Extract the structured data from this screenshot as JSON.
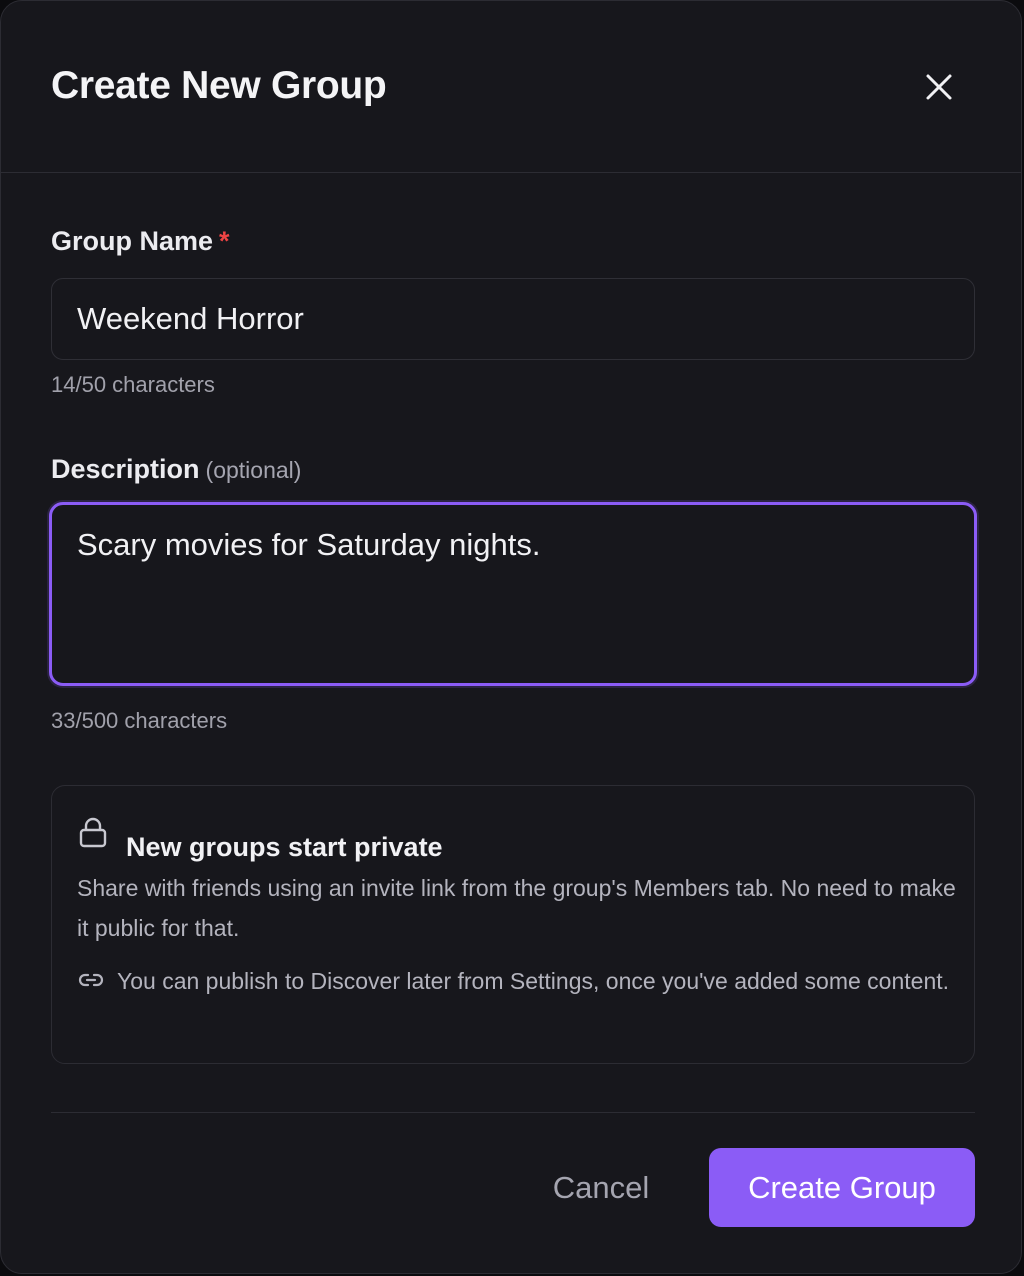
{
  "dialog": {
    "title": "Create New Group",
    "close_icon": "close-icon"
  },
  "form": {
    "name": {
      "label": "Group Name",
      "required_mark": "*",
      "value": "Weekend Horror",
      "counter": "14/50 characters"
    },
    "description": {
      "label": "Description",
      "optional_text": "(optional)",
      "value": "Scary movies for Saturday nights.",
      "counter": "33/500 characters"
    }
  },
  "info": {
    "icon": "lock-icon",
    "title": "New groups start private",
    "text": "Share with friends using an invite link from the group's Members tab. No need to make it public for that.",
    "sub_icon": "link-icon",
    "sub_text": "You can publish to Discover later from Settings, once you've added some content."
  },
  "footer": {
    "cancel_label": "Cancel",
    "create_label": "Create Group"
  },
  "colors": {
    "accent": "#8b5cf6",
    "background": "#17171c",
    "required": "#ef4444"
  }
}
